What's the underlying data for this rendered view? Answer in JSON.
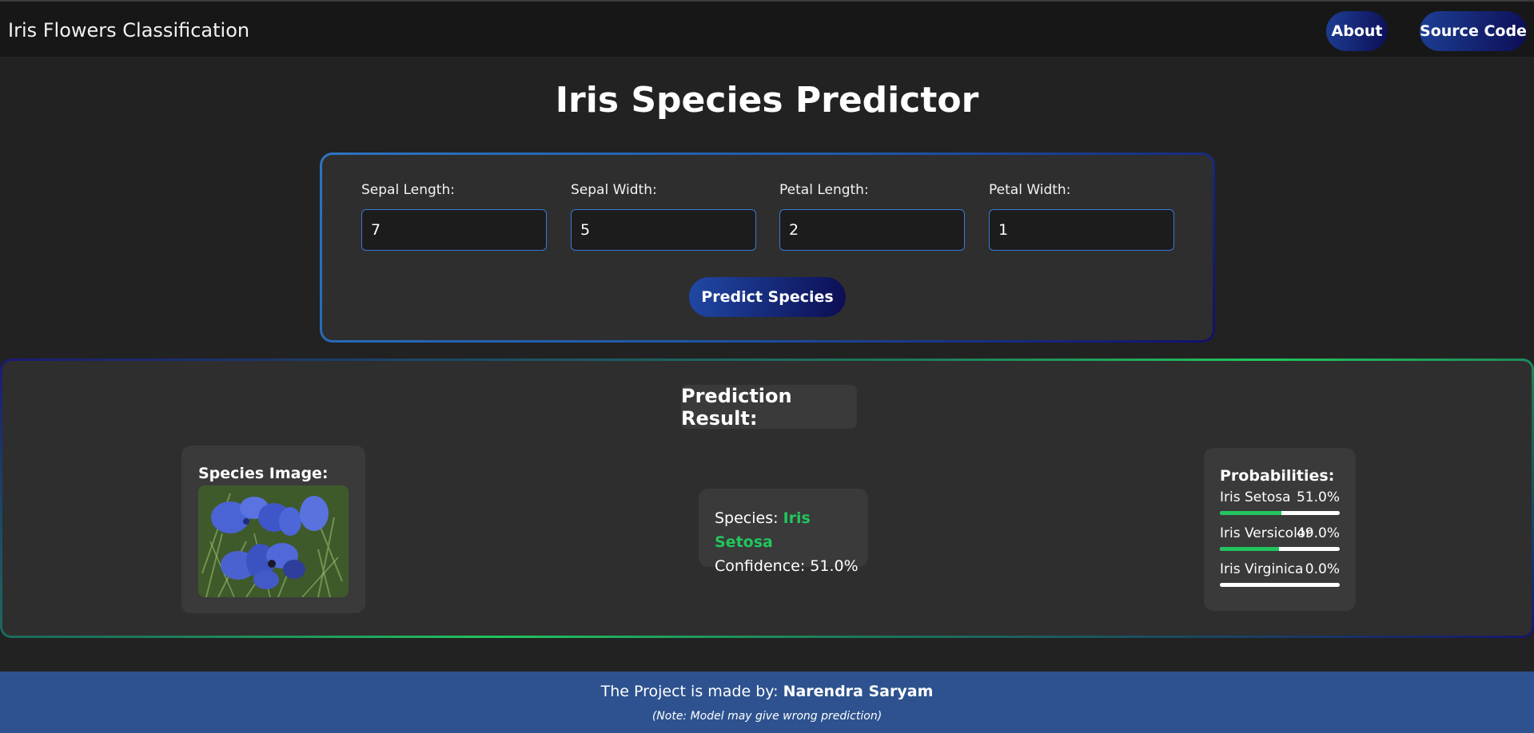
{
  "navbar": {
    "brand": "Iris Flowers Classification",
    "about_label": "About",
    "source_label": "Source Code"
  },
  "page_title": "Iris Species Predictor",
  "form": {
    "fields": [
      {
        "label": "Sepal Length:",
        "value": "7"
      },
      {
        "label": "Sepal Width:",
        "value": "5"
      },
      {
        "label": "Petal Length:",
        "value": "2"
      },
      {
        "label": "Petal Width:",
        "value": "1"
      }
    ],
    "submit_label": "Predict Species"
  },
  "result": {
    "heading": "Prediction Result:",
    "image_title": "Species Image:",
    "species_label": "Species:",
    "species_value": "Iris Setosa",
    "confidence_label": "Confidence:",
    "confidence_value": "51.0%",
    "probabilities_title": "Probabilities:",
    "probabilities": [
      {
        "name": "Iris Setosa",
        "percent": "51.0%",
        "fraction": 0.51
      },
      {
        "name": "Iris Versicolor",
        "percent": "49.0%",
        "fraction": 0.49
      },
      {
        "name": "Iris Virginica",
        "percent": "0.0%",
        "fraction": 0.0
      }
    ]
  },
  "footer": {
    "made_by_text": "The Project is made by:",
    "author": "Narendra Saryam",
    "note": "(Note: Model may give wrong prediction)"
  },
  "colors": {
    "accent_green": "#22c55e",
    "footer_blue": "#2d528f",
    "button_gradient_start": "#2049a5",
    "button_gradient_end": "#0c0d52"
  }
}
